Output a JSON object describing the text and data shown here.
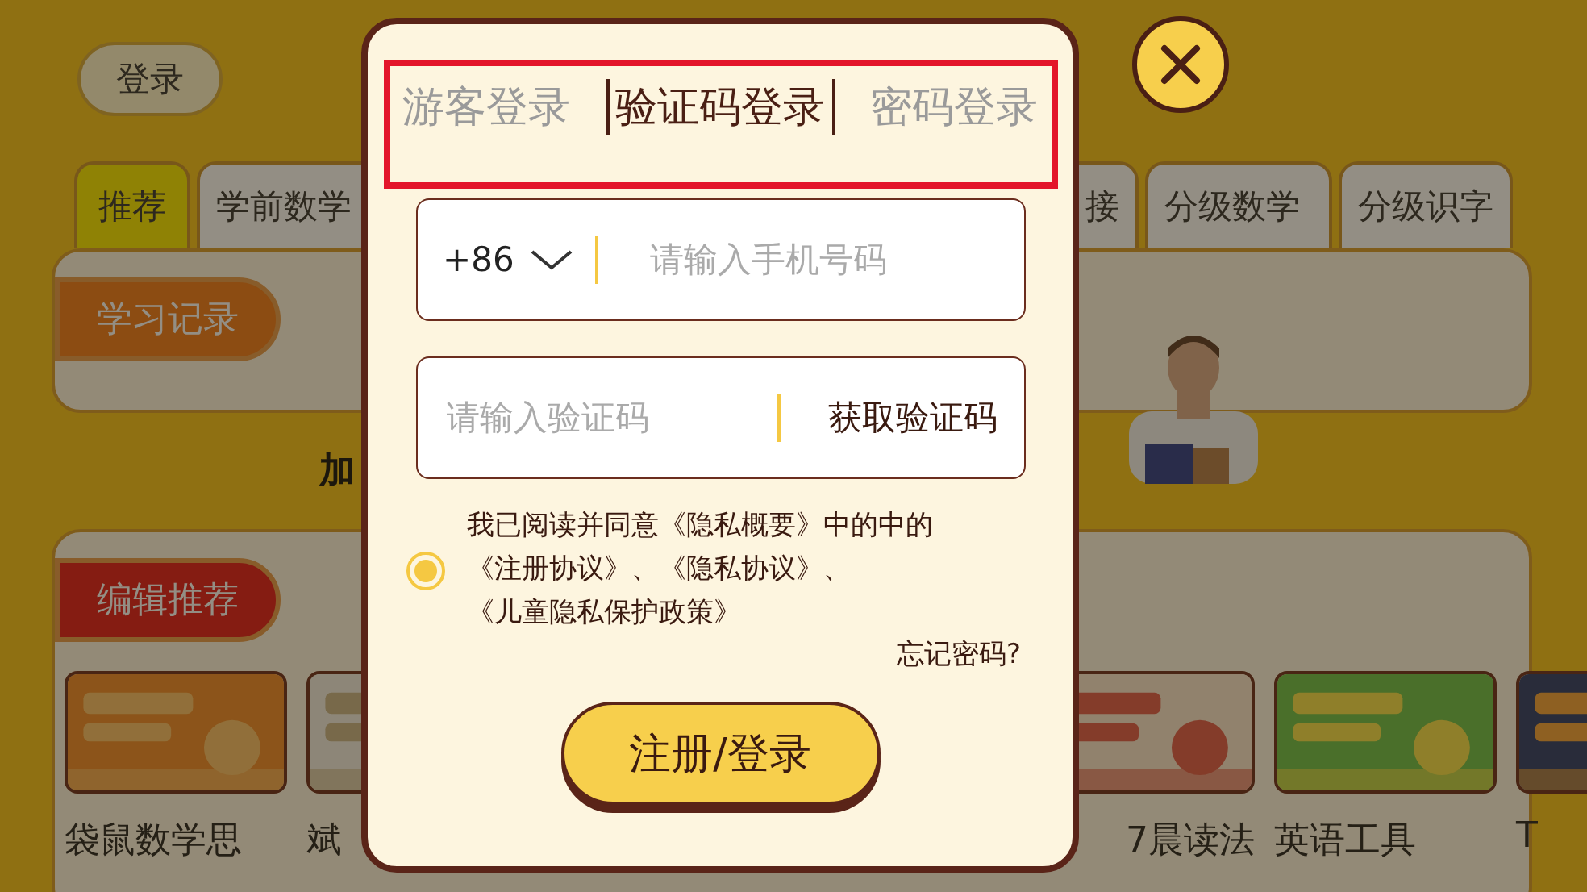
{
  "background": {
    "login_button": "登录",
    "tabs": [
      {
        "label": "推荐",
        "selected": true
      },
      {
        "label": "学前数学",
        "selected": false
      },
      {
        "label": "接",
        "selected": false
      },
      {
        "label": "分级数学",
        "selected": false
      },
      {
        "label": "分级识字",
        "selected": false
      }
    ],
    "history": {
      "label": "学习记录"
    },
    "promo_text": "加",
    "recommend": {
      "label": "编辑推荐",
      "items": [
        {
          "caption": "袋鼠数学思"
        },
        {
          "caption": "斌"
        },
        {
          "caption": "7晨读法"
        },
        {
          "caption": "英语工具"
        },
        {
          "caption": "T"
        }
      ]
    }
  },
  "dialog": {
    "tabs": [
      {
        "label": "游客登录",
        "selected": false
      },
      {
        "label": "验证码登录",
        "selected": true
      },
      {
        "label": "密码登录",
        "selected": false
      }
    ],
    "phone": {
      "country_code": "+86",
      "placeholder": "请输入手机号码"
    },
    "code": {
      "placeholder": "请输入验证码",
      "button": "获取验证码"
    },
    "agreement": {
      "checked": true,
      "lines": [
        "我已阅读并同意《隐私概要》中的中的",
        "《注册协议》、《隐私协议》、",
        "《儿童隐私保护政策》"
      ]
    },
    "forgot": "忘记密码?",
    "submit": "注册/登录"
  }
}
